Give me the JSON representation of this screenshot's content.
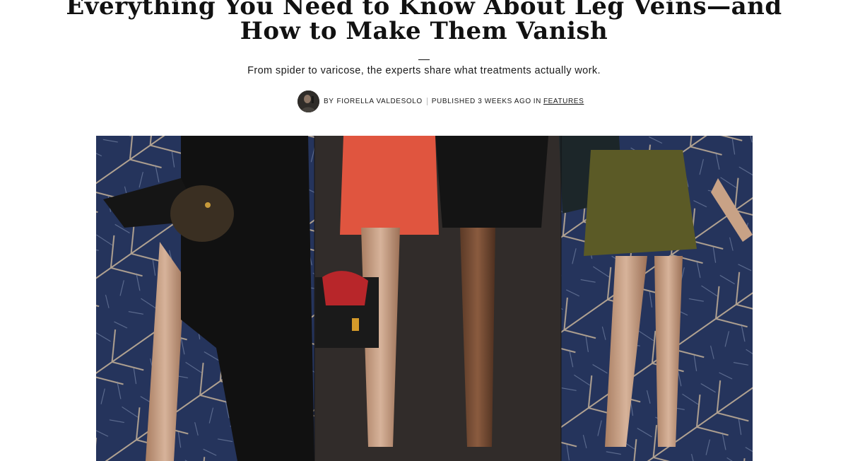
{
  "article": {
    "headline_line1": "Everything You Need to Know About Leg Veins—and",
    "headline_line2": "How to Make Them Vanish",
    "dek": "From spider to varicose, the experts share what treatments actually work."
  },
  "byline": {
    "by": "BY",
    "author": "FIORELLA VALDESOLO",
    "published": "PUBLISHED 3 WEEKS AGO",
    "in": "IN",
    "category": "FEATURES"
  },
  "hero_image": {
    "description_icon": "hero-collage-image",
    "colors": {
      "leaf_background": "#25345c",
      "leaf_veins": "#c9b59a",
      "shorts_red": "#e0553f",
      "dress_olive": "#5b5a26",
      "coat_black": "#111111"
    }
  }
}
